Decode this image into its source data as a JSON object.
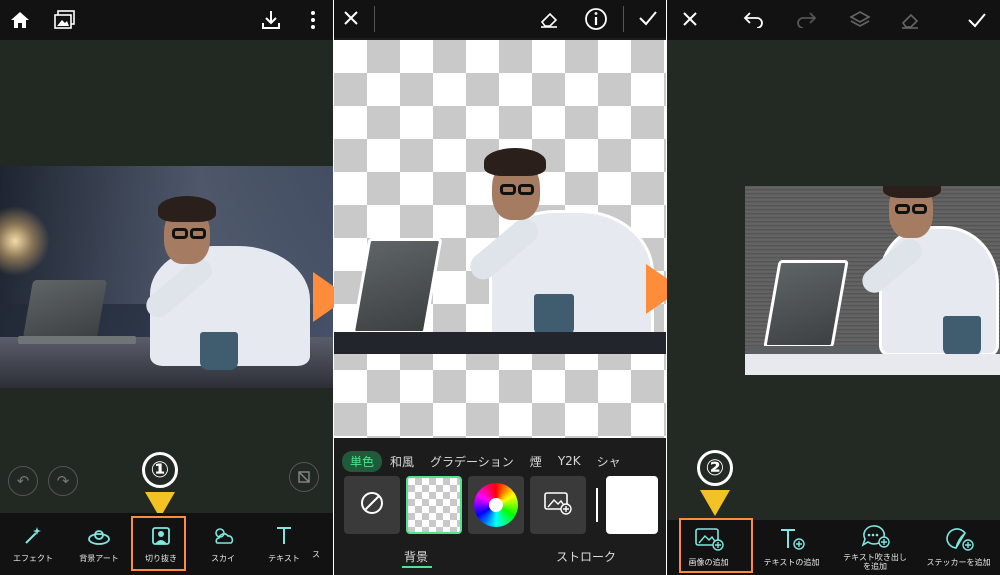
{
  "panel1": {
    "toolbar": [
      {
        "label": "エフェクト",
        "icon": "magic-wand-icon"
      },
      {
        "label": "背景アート",
        "icon": "background-art-icon"
      },
      {
        "label": "切り抜き",
        "icon": "cutout-icon"
      },
      {
        "label": "スカイ",
        "icon": "sky-icon"
      },
      {
        "label": "テキスト",
        "icon": "text-icon"
      }
    ],
    "step_number": "①"
  },
  "panel2": {
    "tabs": [
      "単色",
      "和風",
      "グラデーション",
      "煙",
      "Y2K",
      "シャ"
    ],
    "bottom_tabs": [
      "背景",
      "ストローク"
    ]
  },
  "panel3": {
    "toolbar": [
      {
        "label": "画像の追加",
        "icon": "add-image-icon"
      },
      {
        "label": "テキストの追加",
        "icon": "add-text-icon"
      },
      {
        "label": "テキスト吹き出しを追加",
        "icon": "add-speech-bubble-icon"
      },
      {
        "label": "ステッカーを追加",
        "icon": "add-sticker-icon"
      }
    ],
    "step_number": "②"
  },
  "colors": {
    "highlight": "#ff8c3a",
    "arrow": "#f3c224",
    "accent_green": "#4ee58a"
  }
}
